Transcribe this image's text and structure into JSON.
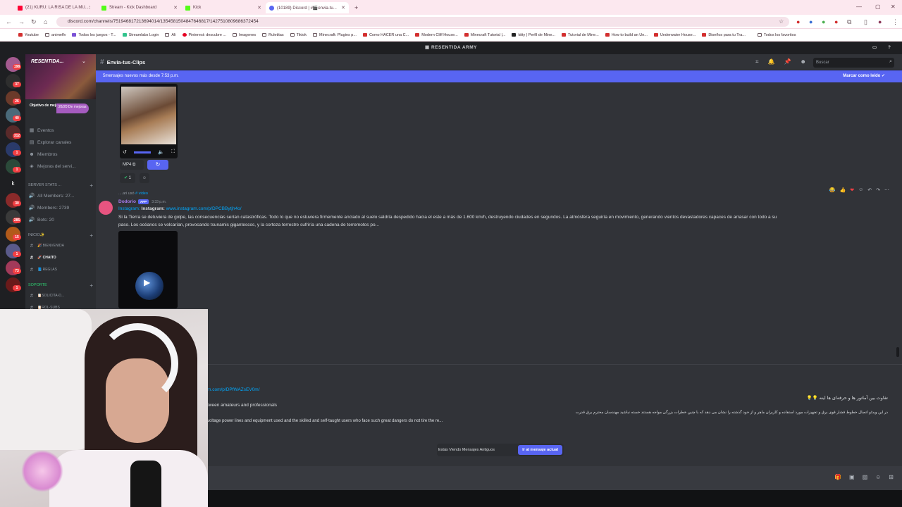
{
  "browser": {
    "tabs": [
      {
        "title": "(21) KURU: LA RISA DE LA MU...",
        "color": "#ff0033"
      },
      {
        "title": "Stream - Kick Dashboard",
        "color": "#53fc18"
      },
      {
        "title": "Kick",
        "color": "#53fc18"
      },
      {
        "title": "(10189) Discord | #🎬envia-tu...",
        "color": "#5865f2"
      }
    ],
    "url": "discord.com/channels/751946817213694014/1354581504847646817/1427510809686372454",
    "bookmarks": [
      "Youtube",
      "animeflv",
      "Todos los juegos - T...",
      "Streamlabs Login",
      "Ali",
      "Pinterest: descubre ...",
      "Imagenes",
      "Ruletitas",
      "Tiktok",
      "Minecraft: Plugins p...",
      "Como HACER una C...",
      "Modern Cliff House...",
      "Minecraft Tutorial |...",
      "kitty | Perfil de Mine...",
      "Tutorial de Mine...",
      "How to build an Un...",
      "Underwater House...",
      "Diseños para tu Tra..."
    ],
    "bookmarks_right": "Todos los favoritos"
  },
  "discord": {
    "server_title": "RESENTIDA ARMY",
    "server_name": "RESENTIDA...",
    "goal_label": "Objetivo de mejora",
    "goal_progress": "26/20 De mejoras",
    "nav": [
      "Eventos",
      "Explorar canales",
      "Miembros",
      "Mejoras del servi..."
    ],
    "stats_category": "SERVER STATS ...",
    "stats": [
      "All Members: 27...",
      "Members: 2739",
      "Bots: 20"
    ],
    "inicio_category": "INICIO✨",
    "inicio_channels": [
      "🎉 BIENVENIDA",
      "🚀 CHAITO",
      "📘 REGLAS"
    ],
    "soporte_category": "SOPORTE",
    "soporte_channels": [
      "📋SOLICITA-D...",
      "📋ROL-SUBS"
    ],
    "guild_badges": [
      "198",
      "37",
      "26",
      "40",
      "312",
      "1",
      "1",
      "30",
      "285",
      "15",
      "1",
      "73",
      "1"
    ],
    "channel_name": "Envia-tus-Clips",
    "search_placeholder": "Buscar",
    "new_messages": "5mensajes nuevos más desde 7:53 p.m.",
    "mark_read": "Marcar como leído",
    "media_format": "MP4",
    "reaction_count": "1",
    "msg2": {
      "reply_user": "....ari usó",
      "reply_cmd": "# video",
      "author": "Dodorio",
      "app": "APP",
      "time": "3:33 p.m.",
      "source": "Instagram:",
      "source_bold": "Instagram:",
      "link": "www.instagram.com/p/DPCBBytjh4o/",
      "text1": "Si la Tierra se detuviera de golpe, las consecuencias serían catastróficas. Todo lo que no estuviera firmemente anclado al suelo saldría despedido hacia el este a más de 1.600 km/h, destruyendo ciudades en segundos. La atmósfera seguiría en movimiento, generando vientos devastadores capaces de arrasar con todo a su",
      "text2": "paso. Los océanos se volcarían, provocando tsunamis gigantescos, y la corteza terrestre sufriría una cadena de terremotos po..."
    },
    "msg3": {
      "link": "m.com/p/DPfWAZsEV0m/",
      "text_en1": "tween amateurs and professionals",
      "text_en2": "voltage power lines and equipment used and the skilled and self-taught users who face such great dangers do not tire the re...",
      "text_fa1": "تفاوت بین آماتور ها و حرفه‌ای ها اینه 💡💡",
      "text_fa2": "در این ویدئو اتصال خطوط فشار قوی برق و تجهیزات مورد استفاده و کاربران ماهر و از خود گذشته را نشان می دهد که با چنین خطرات بزرگی مواجه هستند خسته نباشید مهندسان محترم برق قدرت"
    },
    "old_messages": "Estás Viendo Mensajes Antiguos",
    "jump_present": "Ir al mensaje actual"
  }
}
